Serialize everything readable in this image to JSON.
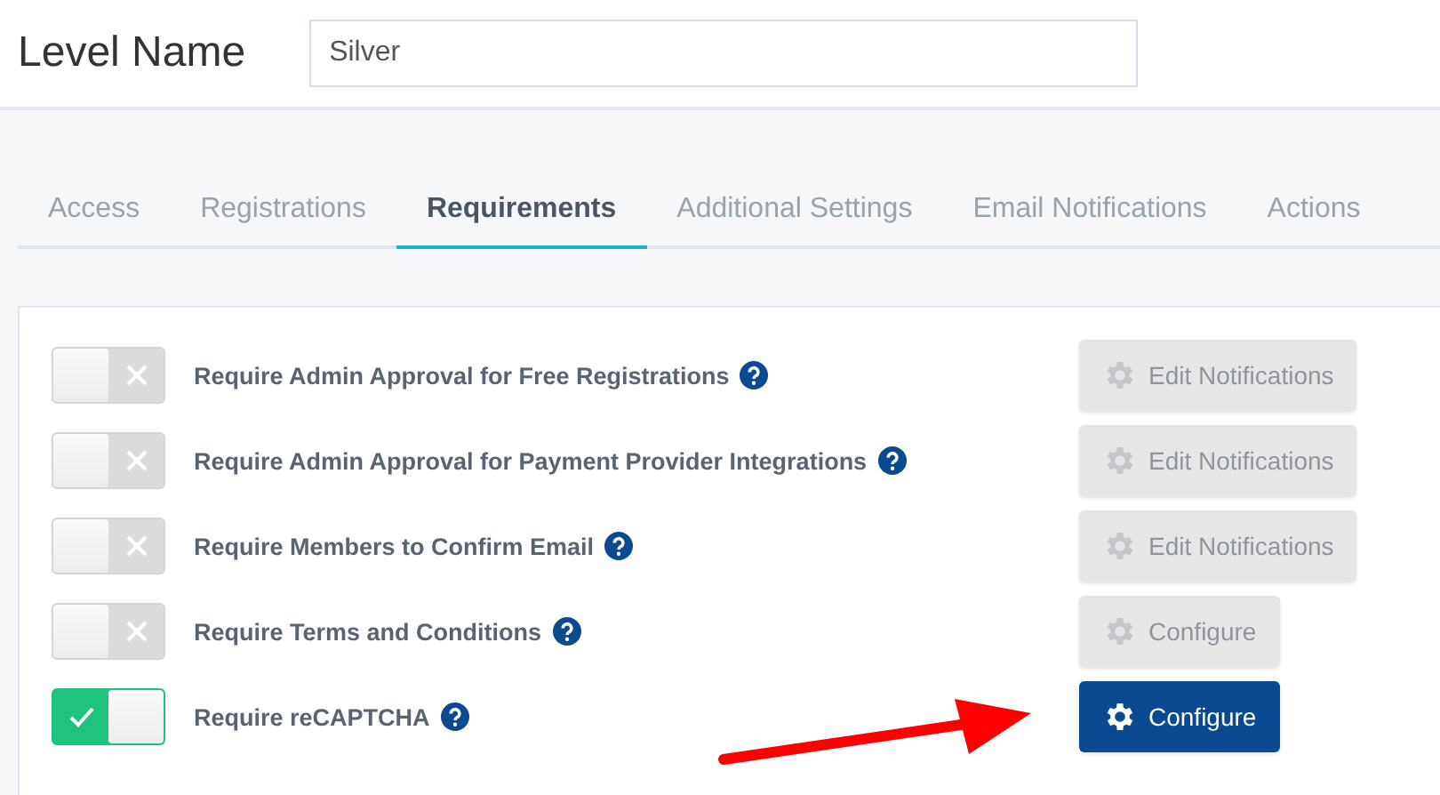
{
  "header": {
    "label": "Level Name",
    "field_value": "Silver"
  },
  "tabs": [
    {
      "label": "Access",
      "selected": false
    },
    {
      "label": "Registrations",
      "selected": false
    },
    {
      "label": "Requirements",
      "selected": true
    },
    {
      "label": "Additional Settings",
      "selected": false
    },
    {
      "label": "Email Notifications",
      "selected": false
    },
    {
      "label": "Actions",
      "selected": false
    }
  ],
  "requirements": [
    {
      "label": "Require Admin Approval for Free Registrations",
      "on": false,
      "button": {
        "label": "Edit Notifications",
        "disabled": true
      }
    },
    {
      "label": "Require Admin Approval for Payment Provider Integrations",
      "on": false,
      "button": {
        "label": "Edit Notifications",
        "disabled": true
      }
    },
    {
      "label": "Require Members to Confirm Email",
      "on": false,
      "button": {
        "label": "Edit Notifications",
        "disabled": true
      }
    },
    {
      "label": "Require Terms and Conditions",
      "on": false,
      "button": {
        "label": "Configure",
        "disabled": true
      }
    },
    {
      "label": "Require reCAPTCHA",
      "on": true,
      "button": {
        "label": "Configure",
        "disabled": false
      }
    }
  ],
  "annotation": {
    "kind": "arrow"
  }
}
